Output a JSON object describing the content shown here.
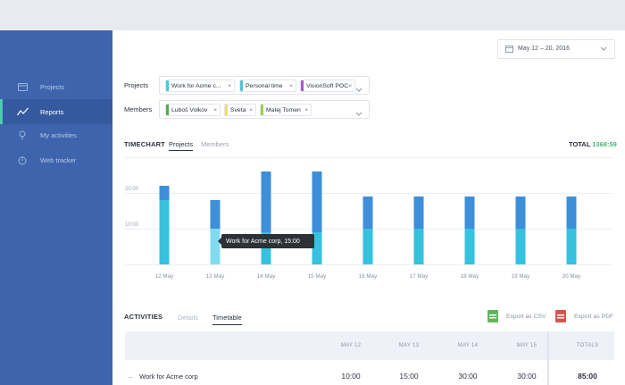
{
  "sidebar": {
    "items": [
      {
        "label": "Projects",
        "icon": "folder-icon"
      },
      {
        "label": "Reports",
        "icon": "chart-icon",
        "active": true
      },
      {
        "label": "My activities",
        "icon": "pin-icon"
      },
      {
        "label": "Web tracker",
        "icon": "stopwatch-icon"
      }
    ]
  },
  "date_range": "May 12 – 20, 2016",
  "filters": {
    "projects_label": "Projects",
    "members_label": "Members",
    "projects": [
      {
        "label": "Work for Acme c...",
        "color": "#4ec6d8"
      },
      {
        "label": "Personal time",
        "color": "#4ec6d8"
      },
      {
        "label": "VisionSoft POC",
        "color": "#a45cc9"
      }
    ],
    "members": [
      {
        "label": "Luboš Volkov",
        "color": "#4caf50"
      },
      {
        "label": "Sveta",
        "color": "#f0e25a"
      },
      {
        "label": "Matej Tomen",
        "color": "#9ad04f"
      }
    ],
    "remove_glyph": "×"
  },
  "timechart": {
    "title": "TIMECHART",
    "tabs": [
      "Projects",
      "Members"
    ],
    "total_label": "TOTAL",
    "total_value": "1368:59",
    "tooltip": "Work for Acme corp, 15:00"
  },
  "chart_data": {
    "type": "bar",
    "stacked": true,
    "categories": [
      "12 May",
      "13 May",
      "14 May",
      "15 May",
      "16 May",
      "17 May",
      "18 May",
      "19 May",
      "20 May"
    ],
    "series": [
      {
        "values": [
          18,
          10,
          9,
          9,
          10,
          10,
          10,
          10,
          10
        ]
      },
      {
        "values": [
          4,
          8,
          17,
          17,
          9,
          9,
          9,
          9,
          9
        ]
      }
    ],
    "colors": [
      "#36c1de",
      "#3d8fd9"
    ],
    "highlight_index": 1,
    "highlight_color": "#7fdcf0",
    "ylim": [
      0,
      31
    ],
    "yticks": [
      {
        "value": 20,
        "label": "20:00"
      },
      {
        "value": 10,
        "label": "10:00"
      }
    ]
  },
  "activities": {
    "title": "ACTIVITIES",
    "tabs": [
      "Details",
      "Timetable"
    ],
    "export_csv": "Export as CSV",
    "export_pdf": "Export as PDF",
    "columns": [
      "MAY 12",
      "MAY 13",
      "MAY 14",
      "MAY 15",
      "TOTALS"
    ],
    "rows": [
      {
        "dash": "–",
        "name": "Work for Acme corp",
        "values": [
          "10:00",
          "15:00",
          "30:00",
          "30:00",
          "85:00"
        ]
      }
    ]
  }
}
